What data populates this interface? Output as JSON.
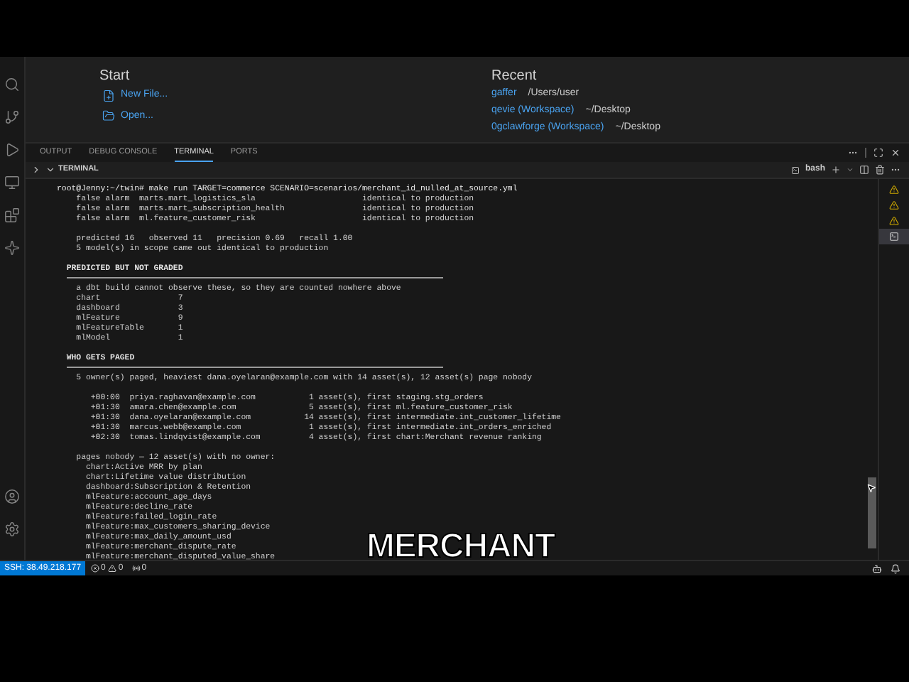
{
  "welcome": {
    "start": {
      "title": "Start",
      "actions": [
        {
          "kind": "new-file",
          "label": "New File..."
        },
        {
          "kind": "open",
          "label": "Open..."
        }
      ]
    },
    "recent": {
      "title": "Recent",
      "items": [
        {
          "name": "gaffer",
          "path": "/Users/user"
        },
        {
          "name": "qevie (Workspace)",
          "path": "~/Desktop"
        },
        {
          "name": "0gclawforge (Workspace)",
          "path": "~/Desktop"
        }
      ]
    }
  },
  "panel": {
    "tabs": [
      {
        "label": "OUTPUT",
        "selected": false
      },
      {
        "label": "DEBUG CONSOLE",
        "selected": false
      },
      {
        "label": "TERMINAL",
        "selected": true
      },
      {
        "label": "PORTS",
        "selected": false
      }
    ],
    "section": {
      "title": "TERMINAL",
      "expanded": true
    },
    "shell": "bash",
    "sessions": [
      {
        "kind": "warning",
        "selected": false
      },
      {
        "kind": "warning",
        "selected": false
      },
      {
        "kind": "warning",
        "selected": false
      },
      {
        "kind": "shell",
        "selected": true
      }
    ],
    "lines": [
      {
        "kind": "command",
        "text": "root@Jenny:~/twin# make run TARGET=commerce SCENARIO=scenarios/merchant_id_nulled_at_source.yml"
      },
      {
        "kind": "output",
        "text": "    false alarm  marts.mart_logistics_sla                      identical to production"
      },
      {
        "kind": "output",
        "text": "    false alarm  marts.mart_subscription_health                identical to production"
      },
      {
        "kind": "output",
        "text": "    false alarm  ml.feature_customer_risk                      identical to production"
      },
      {
        "kind": "output",
        "gap_before": true,
        "text": "    predicted 16   observed 11   precision 0.69   recall 1.00"
      },
      {
        "kind": "output",
        "text": "    5 model(s) in scope came out identical to production"
      },
      {
        "kind": "heading",
        "gap_before": true,
        "text": "  PREDICTED BUT NOT GRADED"
      },
      {
        "kind": "rule"
      },
      {
        "kind": "output",
        "text": "    a dbt build cannot observe these, so they are counted nowhere above"
      },
      {
        "kind": "output",
        "text": "    chart                7"
      },
      {
        "kind": "output",
        "text": "    dashboard            3"
      },
      {
        "kind": "output",
        "text": "    mlFeature            9"
      },
      {
        "kind": "output",
        "text": "    mlFeatureTable       1"
      },
      {
        "kind": "output",
        "text": "    mlModel              1"
      },
      {
        "kind": "heading",
        "gap_before": true,
        "text": "  WHO GETS PAGED"
      },
      {
        "kind": "rule"
      },
      {
        "kind": "output",
        "text": "    5 owner(s) paged, heaviest dana.oyelaran@example.com with 14 asset(s), 12 asset(s) page nobody"
      },
      {
        "kind": "output",
        "gap_before": true,
        "text": "       +00:00  priya.raghavan@example.com           1 asset(s), first staging.stg_orders"
      },
      {
        "kind": "output",
        "text": "       +01:30  amara.chen@example.com               5 asset(s), first ml.feature_customer_risk"
      },
      {
        "kind": "output",
        "text": "       +01:30  dana.oyelaran@example.com           14 asset(s), first intermediate.int_customer_lifetime"
      },
      {
        "kind": "output",
        "text": "       +01:30  marcus.webb@example.com              1 asset(s), first intermediate.int_orders_enriched"
      },
      {
        "kind": "output",
        "text": "       +02:30  tomas.lindqvist@example.com          4 asset(s), first chart:Merchant revenue ranking"
      },
      {
        "kind": "output",
        "gap_before": true,
        "text": "    pages nobody — 12 asset(s) with no owner:"
      },
      {
        "kind": "output",
        "text": "      chart:Active MRR by plan"
      },
      {
        "kind": "output",
        "text": "      chart:Lifetime value distribution"
      },
      {
        "kind": "output",
        "text": "      dashboard:Subscription & Retention"
      },
      {
        "kind": "output",
        "text": "      mlFeature:account_age_days"
      },
      {
        "kind": "output",
        "text": "      mlFeature:decline_rate"
      },
      {
        "kind": "output",
        "text": "      mlFeature:failed_login_rate"
      },
      {
        "kind": "output",
        "text": "      mlFeature:max_customers_sharing_device"
      },
      {
        "kind": "output",
        "text": "      mlFeature:max_daily_amount_usd"
      },
      {
        "kind": "output",
        "text": "      mlFeature:merchant_dispute_rate"
      },
      {
        "kind": "output",
        "text": "      mlFeature:merchant_disputed_value_share"
      }
    ]
  },
  "status_bar": {
    "remote": "SSH: 38.49.218.177",
    "errors": "0",
    "warnings": "0",
    "ports": "0"
  },
  "caption": "MERCHANT"
}
